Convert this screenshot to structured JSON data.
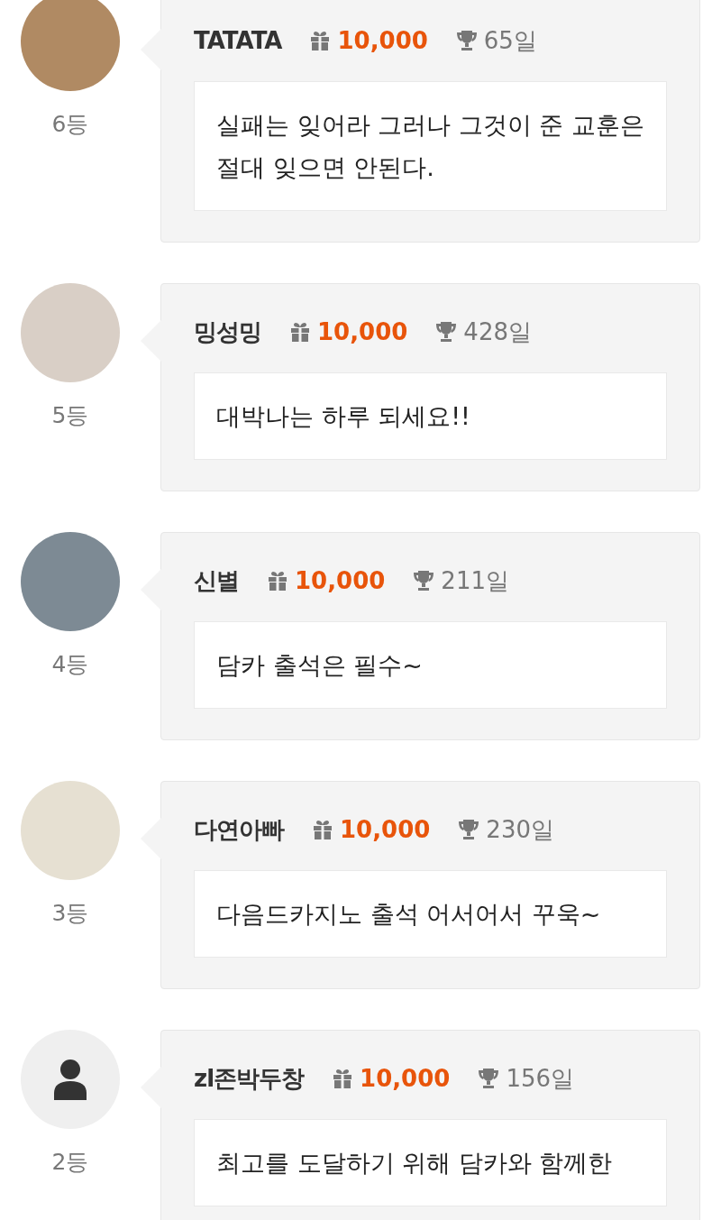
{
  "entries": [
    {
      "avatar": {
        "kind": "photo"
      },
      "name": "TATATA",
      "points": "10,000",
      "days": "65일",
      "rank": "6등",
      "message": "실패는 잊어라 그러나 그것이 준 교훈은 절대 잊으면 안된다."
    },
    {
      "avatar": {
        "kind": "photo"
      },
      "name": "밍성밍",
      "points": "10,000",
      "days": "428일",
      "rank": "5등",
      "message": "대박나는 하루 되세요!!"
    },
    {
      "avatar": {
        "kind": "photo"
      },
      "name": "신별",
      "points": "10,000",
      "days": "211일",
      "rank": "4등",
      "message": "담카 출석은 필수~"
    },
    {
      "avatar": {
        "kind": "photo"
      },
      "name": "다연아빠",
      "points": "10,000",
      "days": "230일",
      "rank": "3등",
      "message": "다음드카지노 출석 어서어서 꾸욱~"
    },
    {
      "avatar": {
        "kind": "default"
      },
      "name": "zl존박두창",
      "points": "10,000",
      "days": "156일",
      "rank": "2등",
      "message": "최고를 도달하기 위해 담카와 함께한"
    }
  ]
}
